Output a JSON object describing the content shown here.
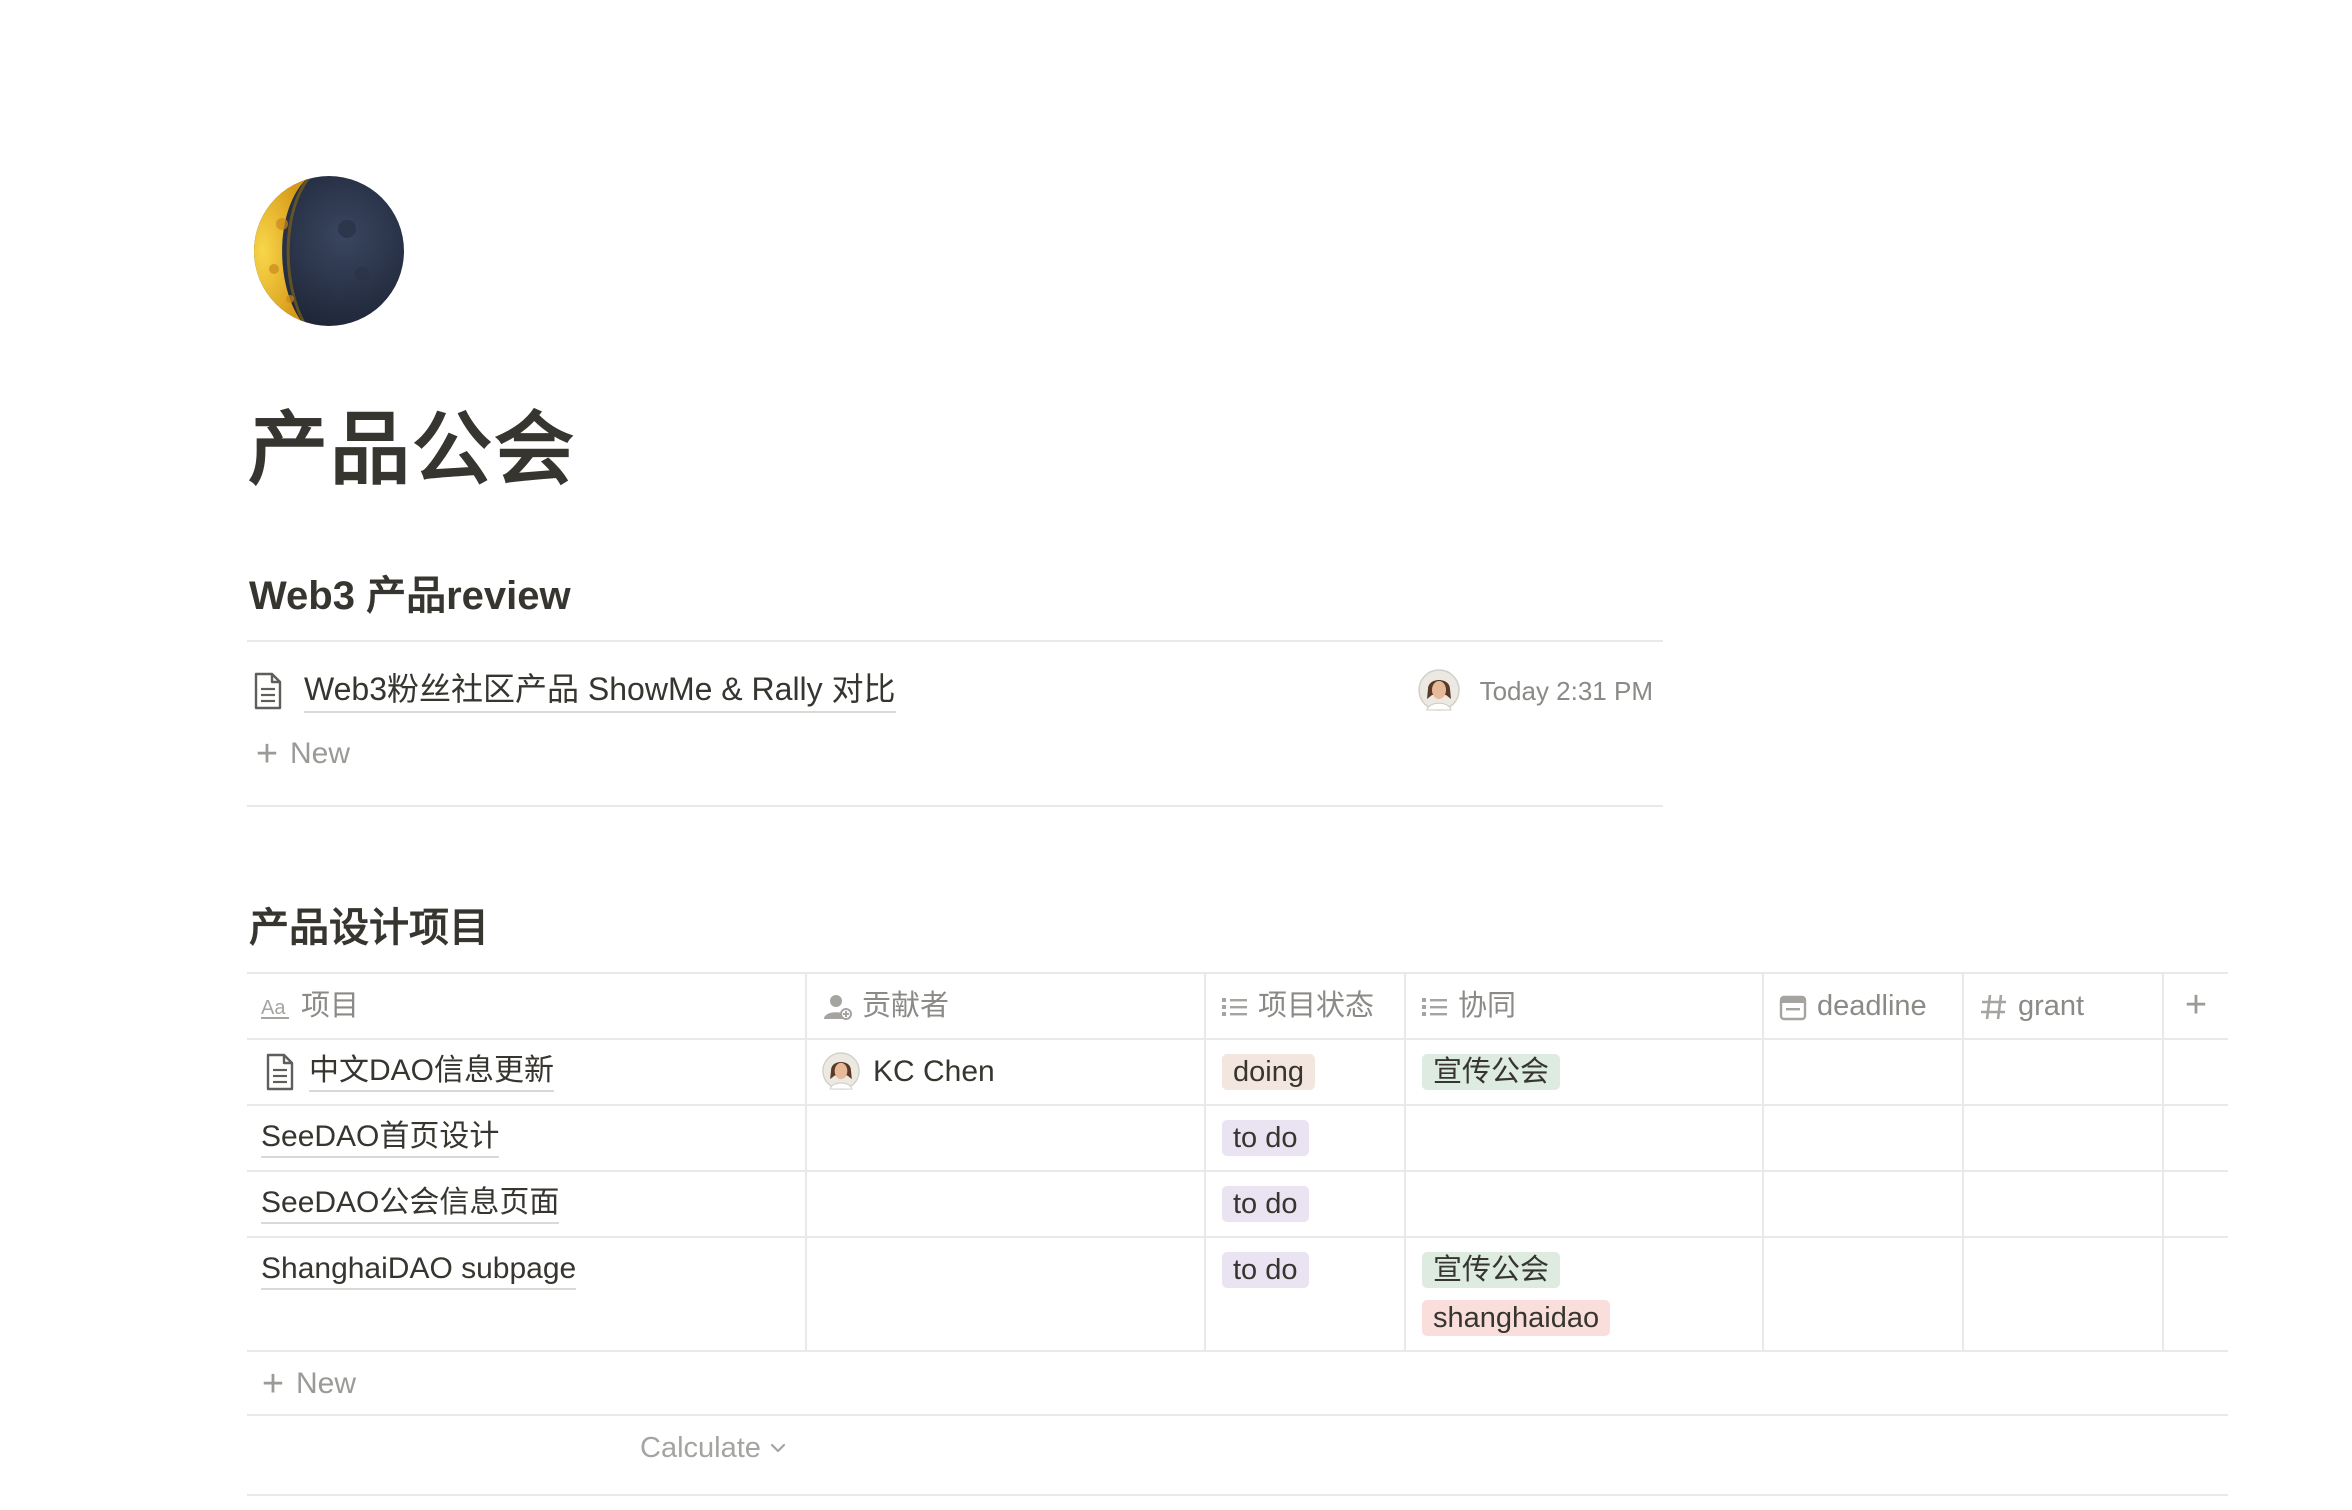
{
  "page": {
    "icon": "waning-crescent-moon-icon",
    "title": "产品公会"
  },
  "review_section": {
    "title": "Web3 产品review",
    "items": [
      {
        "title": "Web3粉丝社区产品 ShowMe & Rally 对比",
        "time": "Today 2:31 PM"
      }
    ],
    "new_label": "New"
  },
  "projects_section": {
    "title": "产品设计项目",
    "columns": {
      "project": "项目",
      "contributor": "贡献者",
      "status": "项目状态",
      "collab": "协同",
      "deadline": "deadline",
      "grant": "grant"
    },
    "rows": [
      {
        "project": "中文DAO信息更新",
        "contributor": "KC Chen",
        "status": "doing",
        "collab": [
          "宣传公会"
        ]
      },
      {
        "project": "SeeDAO首页设计",
        "contributor": "",
        "status": "to do",
        "collab": []
      },
      {
        "project": "SeeDAO公会信息页面",
        "contributor": "",
        "status": "to do",
        "collab": []
      },
      {
        "project": "ShanghaiDAO subpage",
        "contributor": "",
        "status": "to do",
        "collab": [
          "宣传公会",
          "shanghaidao"
        ]
      }
    ],
    "new_label": "New",
    "calculate_label": "Calculate"
  },
  "colors": {
    "text": "#37352f",
    "muted": "#9b9a97",
    "divider": "#e9e9e7",
    "tag_doing": "#f3e6de",
    "tag_todo": "#eae3f2",
    "tag_xuanchuan": "#ddebe0",
    "tag_shanghaidao": "#fadedb"
  }
}
